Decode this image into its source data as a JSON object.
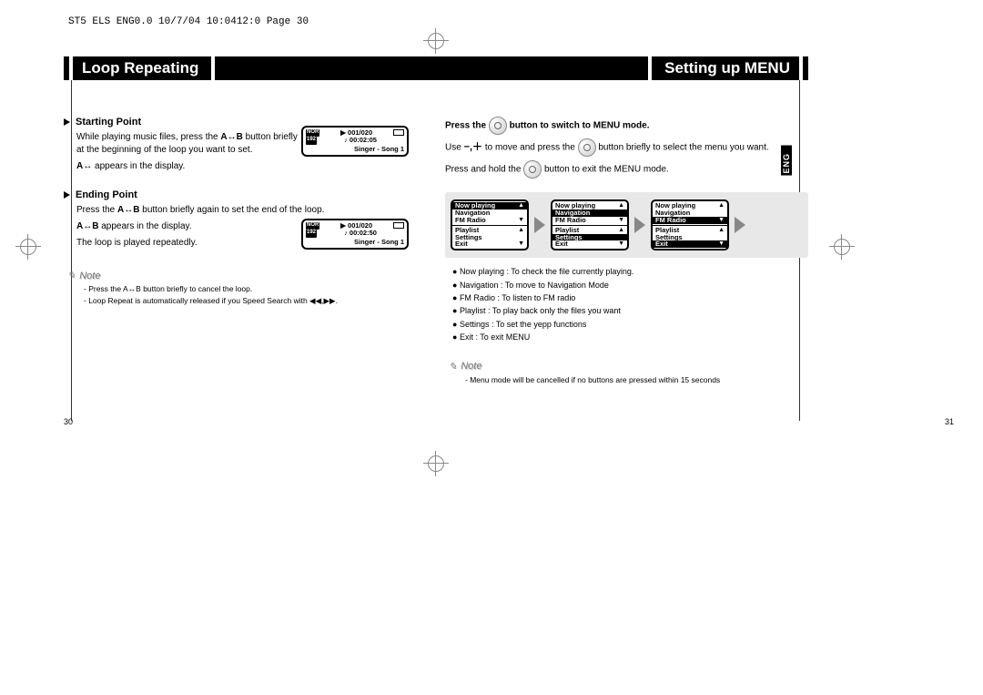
{
  "page_header": "ST5 ELS ENG0.0  10/7/04 10:0412:0  Page 30",
  "title_left": "Loop Repeating",
  "title_right": "Setting up MENU",
  "lang_tab": "ENG",
  "left": {
    "section1_head": "Starting Point",
    "section1_body1a": "While playing music files, press the ",
    "section1_body1b": "A↔B",
    "section1_body1c": " button briefly at the beginning of the loop you want to set.",
    "section1_body2a": "A↔",
    "section1_body2b": " appears in the display.",
    "section2_head": "Ending Point",
    "section2_body1a": "Press the ",
    "section2_body1b": "A↔B",
    "section2_body1c": " button briefly again to set the end of the loop.",
    "section2_body2a": "A↔B",
    "section2_body2b": " appears in the display.",
    "section2_body3": "The loop is played repeatedly.",
    "note_head": "Note",
    "note_line1": "- Press the A↔B button briefly to cancel the loop.",
    "note_line2": "- Loop Repeat is automatically released if you Speed Search with ◀◀,▶▶.",
    "screen1": {
      "nor": "NOR",
      "br": "192",
      "cnt": "001/020",
      "time": "00:02:05",
      "song": "Singer - Song 1",
      "note": "♪"
    },
    "screen2": {
      "nor": "NOR",
      "br": "192",
      "cnt": "001/020",
      "time": "00:02:50",
      "song": "Singer - Song 1",
      "note": "♪"
    }
  },
  "right": {
    "line1a": "Press the",
    "line1b": "button to switch to MENU mode.",
    "line2a": "Use ",
    "line2b": " to move and press the",
    "line2c": "button briefly to select the menu you want.",
    "line2_pm": "−,＋",
    "line3a": "Press and hold the",
    "line3b": "button to exit the MENU mode.",
    "menu_items": [
      "Now playing",
      "Navigation",
      "FM Radio",
      "Playlist",
      "Settings",
      "Exit"
    ],
    "highlights": [
      "Now playing",
      "Navigation",
      "Settings",
      "FM Radio",
      "Exit"
    ],
    "screens": [
      {
        "hl": "Now playing"
      },
      {
        "hl": "Navigation"
      },
      {
        "hl": "FM Radio"
      }
    ],
    "screens_b": [
      {
        "hl": ""
      },
      {
        "hl": "Settings"
      },
      {
        "hl": "Exit"
      }
    ],
    "bullets": [
      "Now playing : To check the file currently playing.",
      "Navigation : To move to Navigation Mode",
      "FM Radio : To listen to FM radio",
      "Playlist : To play back only the files you want",
      "Settings : To set the yepp functions",
      "Exit : To exit MENU"
    ],
    "note_head": "Note",
    "note_line1": "- Menu mode will be cancelled if no buttons are pressed within 15 seconds"
  },
  "page_num_left": "30",
  "page_num_right": "31"
}
